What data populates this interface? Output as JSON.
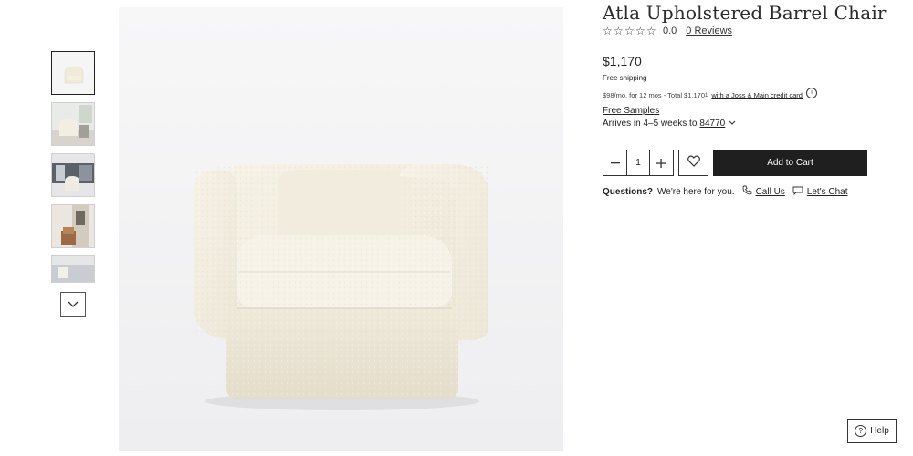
{
  "product": {
    "title": "Atla Upholstered Barrel Chair",
    "rating_value": "0.0",
    "reviews_label": "0 Reviews",
    "price": "$1,170",
    "shipping": "Free shipping",
    "finance_text": "$98/mo. for 12 mos - Total $1,170",
    "finance_superscript": "1",
    "finance_link": "with a Joss & Main credit card",
    "free_samples": "Free Samples",
    "arrives_text": "Arrives in 4–5 weeks to",
    "zip_code": "84770"
  },
  "purchase": {
    "quantity": "1",
    "add_to_cart": "Add to Cart"
  },
  "support": {
    "questions": "Questions?",
    "subtext": "We're here for you.",
    "call_us": "Call Us",
    "chat": "Let's Chat",
    "help": "Help"
  },
  "icons": {
    "star": "star-outline",
    "heart": "heart-outline",
    "phone": "phone-icon",
    "chat": "chat-icon",
    "info": "info-icon",
    "chevron": "chevron-down-icon"
  },
  "colors": {
    "cta_background": "#1f1f1f",
    "chair_fabric": "#f3eee0"
  }
}
